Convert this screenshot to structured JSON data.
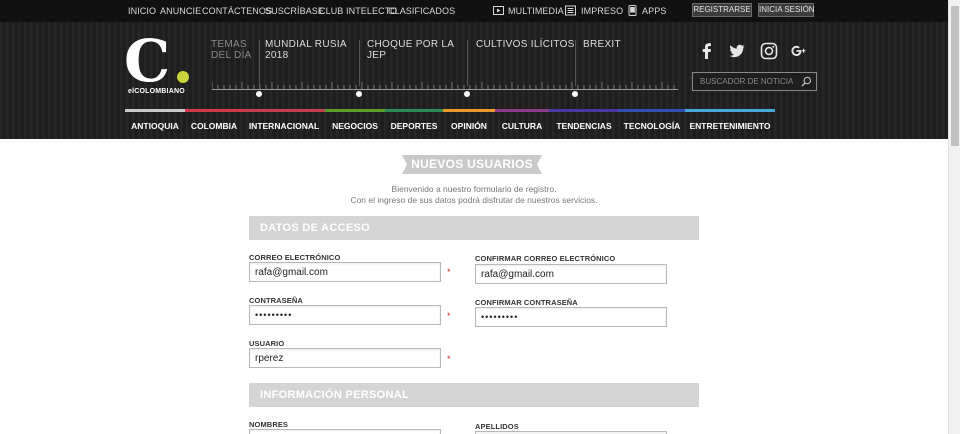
{
  "topbar": {
    "links": [
      "INICIO",
      "ANUNCIE",
      "CONTÁCTENOS",
      "SUSCRÍBASE",
      "CLUB INTELECTO",
      "CLASIFICADOS"
    ],
    "multimedia": "MULTIMEDIA",
    "impreso": "IMPRESO",
    "apps": "APPS",
    "register_btn": "REGISTRARSE",
    "login_btn": "INICIA SESIÓN"
  },
  "header": {
    "logo_brand": "elCOLOMBIANO",
    "temas_label": "TEMAS DEL DÍA",
    "topics": [
      "MUNDIAL RUSIA 2018",
      "CHOQUE POR LA JEP",
      "CULTIVOS ILÍCITOS",
      "BREXIT"
    ],
    "search_placeholder": "BUSCADOR DE NOTICIAS"
  },
  "nav": [
    {
      "label": "ANTIOQUIA",
      "color": "#c8c8c8"
    },
    {
      "label": "COLOMBIA",
      "color": "#d23a4a"
    },
    {
      "label": "INTERNACIONAL",
      "color": "#c5404c"
    },
    {
      "label": "NEGOCIOS",
      "color": "#5aa02c"
    },
    {
      "label": "DEPORTES",
      "color": "#2e8b57"
    },
    {
      "label": "OPINIÓN",
      "color": "#e89a2c"
    },
    {
      "label": "CULTURA",
      "color": "#8a3a8a"
    },
    {
      "label": "TENDENCIAS",
      "color": "#4a3aa0"
    },
    {
      "label": "TECNOLOGÍA",
      "color": "#3050b0"
    },
    {
      "label": "ENTRETENIMIENTO",
      "color": "#4aa8d8"
    }
  ],
  "form": {
    "title": "NUEVOS USUARIOS",
    "intro_line1": "Bienvenido a nuestro formulario de registro.",
    "intro_line2": "Con el ingreso de sus datos podrá disfrutar de nuestros servicios.",
    "section_access": "DATOS DE ACCESO",
    "section_personal": "INFORMACIÓN PERSONAL",
    "email_label": "CORREO ELECTRÓNICO",
    "email_value": "rafa@gmail.com",
    "confirm_email_label": "CONFIRMAR CORREO ELECTRÓNICO",
    "confirm_email_value": "rafa@gmail.com",
    "password_label": "CONTRASEÑA",
    "password_value": "123456789",
    "confirm_password_label": "CONFIRMAR CONTRASEÑA",
    "confirm_password_value": "123456789",
    "username_label": "USUARIO",
    "username_value": "rperez",
    "nombres_label": "NOMBRES",
    "apellidos_label": "APELLIDOS",
    "required_mark": "*"
  }
}
